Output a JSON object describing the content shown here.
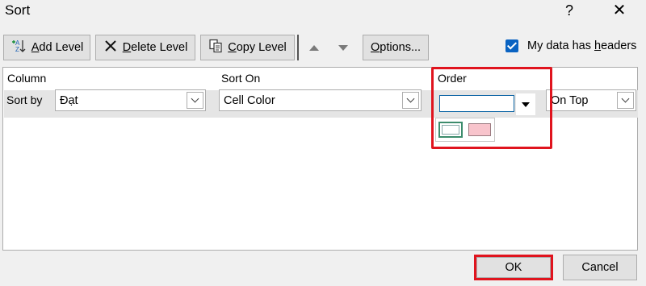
{
  "window": {
    "title": "Sort",
    "help_glyph": "?",
    "close_glyph": "✕"
  },
  "toolbar": {
    "add_level": {
      "prefix_underlined": "A",
      "rest": "dd Level"
    },
    "delete_level": {
      "prefix_underlined": "D",
      "rest": "elete Level"
    },
    "copy_level": {
      "prefix_underlined": "C",
      "rest": "opy Level"
    },
    "options": {
      "prefix_underlined": "O",
      "rest": "ptions..."
    }
  },
  "headers_checkbox": {
    "label_before": "My data has ",
    "label_underlined": "h",
    "label_after": "eaders",
    "checked": true
  },
  "grid": {
    "columns": {
      "column": "Column",
      "sort_on": "Sort On",
      "order": "Order"
    },
    "row": {
      "label": "Sort by",
      "column_value": "Đạt",
      "sort_on_value": "Cell Color",
      "position_value": "On Top"
    }
  },
  "footer": {
    "ok_label": "OK",
    "cancel_label": "Cancel"
  },
  "colors": {
    "highlight": "#e0141e",
    "accent": "#0a63c2",
    "swatch_pink": "#f8c4cc",
    "swatch_border_green": "#3c8c6c"
  }
}
